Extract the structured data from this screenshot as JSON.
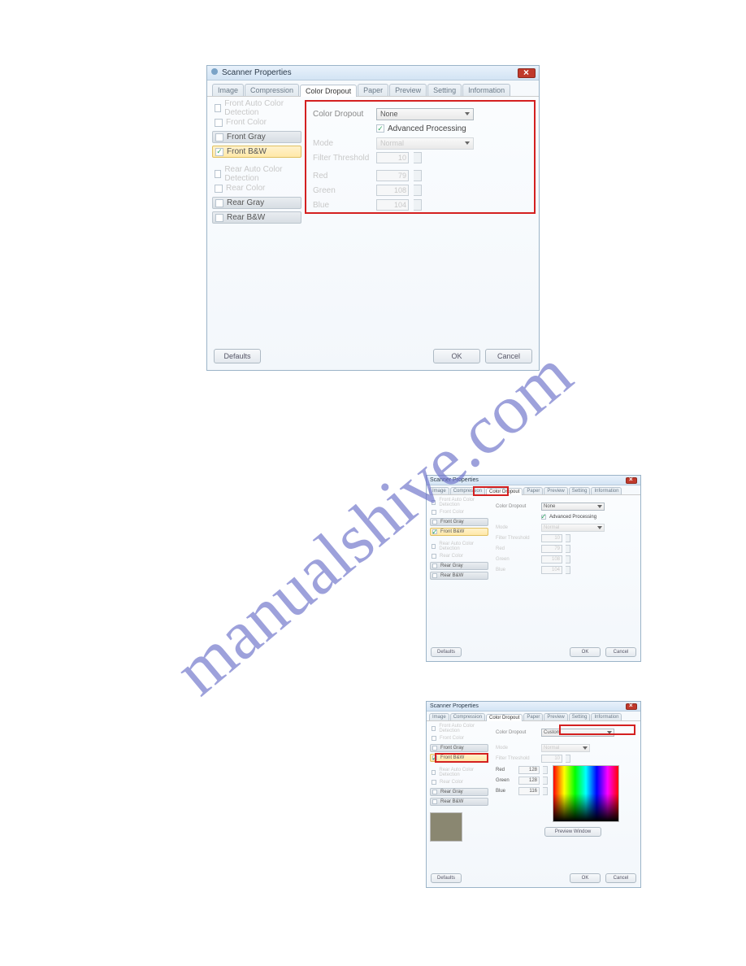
{
  "window": {
    "title": "Scanner Properties",
    "defaults_btn": "Defaults",
    "ok_btn": "OK",
    "cancel_btn": "Cancel"
  },
  "tabs": {
    "image": "Image",
    "compression": "Compression",
    "color_dropout": "Color Dropout",
    "paper": "Paper",
    "preview": "Preview",
    "setting": "Setting",
    "information": "Information"
  },
  "side_items": {
    "front_auto": "Front Auto Color Detection",
    "front_color": "Front Color",
    "front_gray": "Front Gray",
    "front_bw": "Front B&W",
    "rear_auto": "Rear Auto Color Detection",
    "rear_color": "Rear Color",
    "rear_gray": "Rear Gray",
    "rear_bw": "Rear B&W"
  },
  "panel": {
    "color_dropout": "Color Dropout",
    "none": "None",
    "custom": "Custom",
    "adv_processing": "Advanced Processing",
    "mode": "Mode",
    "normal": "Normal",
    "filter_threshold": "Filter Threshold",
    "red": "Red",
    "green": "Green",
    "blue": "Blue",
    "val_thresh": "10",
    "val_red": "79",
    "val_green": "108",
    "val_blue": "104",
    "val_red2": "128",
    "val_green2": "128",
    "val_blue2": "116",
    "preview_window": "Preview Window"
  },
  "watermark": "manualshive.com"
}
